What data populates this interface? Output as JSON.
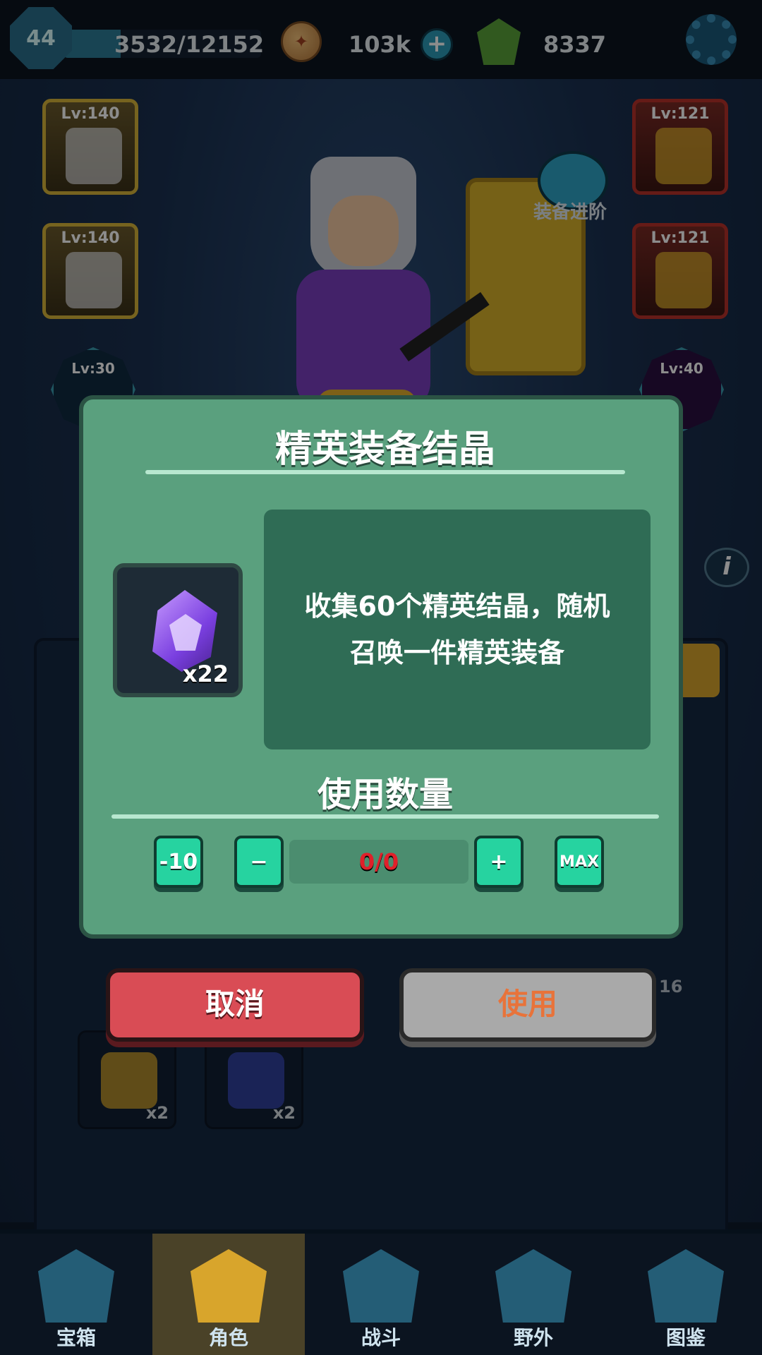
{
  "topbar": {
    "level": "44",
    "xp_text": "3532/12152",
    "xp_progress": 0.29,
    "coins": "103k",
    "gems": "8337",
    "icons": [
      "level-badge-icon",
      "coin-icon",
      "plus-icon",
      "gem-icon",
      "gear-icon"
    ]
  },
  "equipment": {
    "left_slots": [
      {
        "label": "Lv:140"
      },
      {
        "label": "Lv:140"
      }
    ],
    "right_slots": [
      {
        "label": "Lv:121"
      },
      {
        "label": "Lv:121"
      }
    ],
    "left_hex": {
      "label": "Lv:30"
    },
    "right_hex": {
      "label": "Lv:40"
    },
    "advance_label": "装备进阶"
  },
  "inventory": {
    "items": [
      {
        "count": "x2",
        "color": "#d8a52c"
      },
      {
        "count": "x2",
        "color": "#3a4ab8"
      }
    ],
    "side_count": "16"
  },
  "dialog": {
    "title": "精英装备结晶",
    "item_quantity": "x22",
    "description": "收集60个精英结晶，随机召唤一件精英装备",
    "qty_title": "使用数量",
    "minus10_label": "-10",
    "minus_label": "−",
    "value": "0/0",
    "plus_label": "+",
    "max_label": "MAX"
  },
  "buttons": {
    "cancel": "取消",
    "use": "使用"
  },
  "nav": [
    {
      "label": "宝箱",
      "icon": "chest-icon",
      "active": false
    },
    {
      "label": "角色",
      "icon": "helmet-icon",
      "active": true
    },
    {
      "label": "战斗",
      "icon": "crossed-swords-icon",
      "active": false
    },
    {
      "label": "野外",
      "icon": "castle-icon",
      "active": false
    },
    {
      "label": "图鉴",
      "icon": "book-icon",
      "active": false
    }
  ],
  "colors": {
    "dialog_bg": "#5aa07e",
    "cancel": "#d94c55",
    "use_disabled": "#a9a9a9",
    "stepper": "#26d3a0",
    "value_text": "#e0202a"
  }
}
